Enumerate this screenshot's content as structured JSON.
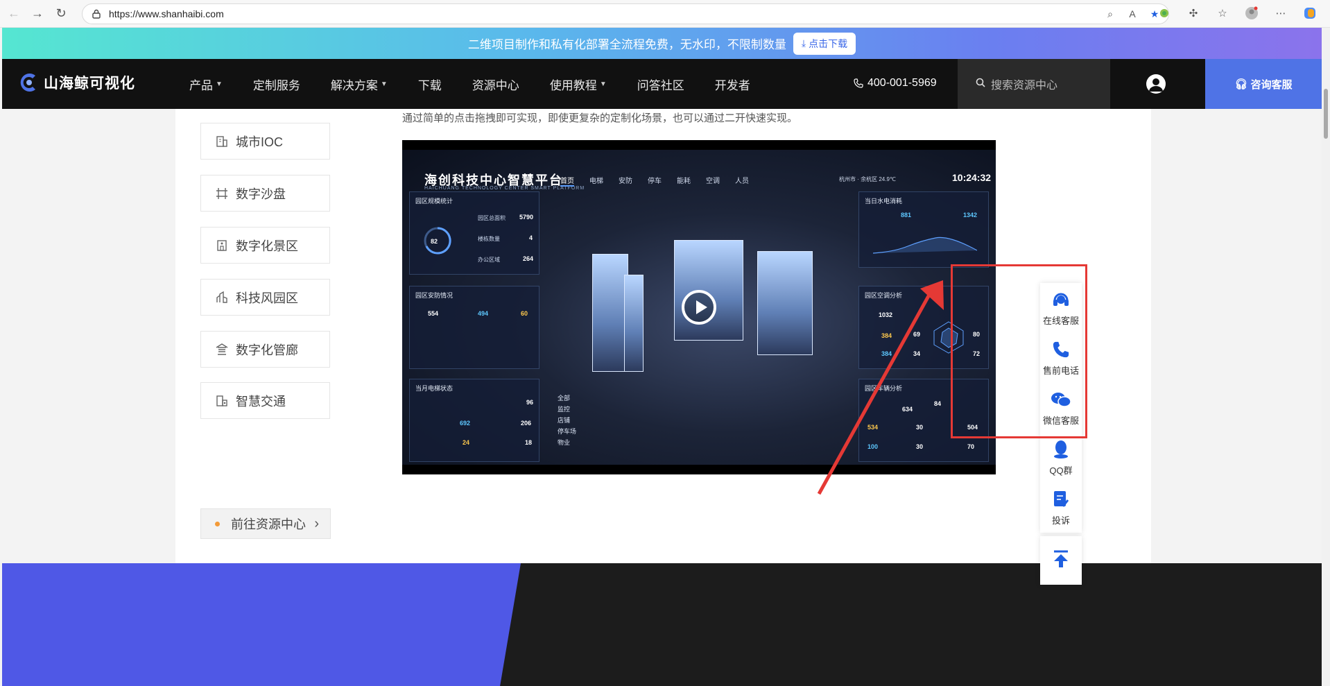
{
  "browser": {
    "url": "https://www.shanhaibi.com"
  },
  "promo": {
    "text": "二维项目制作和私有化部署全流程免费，无水印，不限制数量",
    "button_label": "点击下载"
  },
  "nav": {
    "logo_text": "山海鲸可视化",
    "menu": [
      {
        "label": "产品",
        "dropdown": true
      },
      {
        "label": "定制服务",
        "dropdown": false
      },
      {
        "label": "解决方案",
        "dropdown": true
      },
      {
        "label": "下载",
        "dropdown": false
      },
      {
        "label": "资源中心",
        "dropdown": false
      },
      {
        "label": "使用教程",
        "dropdown": true
      },
      {
        "label": "问答社区",
        "dropdown": false
      },
      {
        "label": "开发者",
        "dropdown": false
      }
    ],
    "phone": "400-001-5969",
    "search_placeholder": "搜索资源中心",
    "consult_label": "咨询客服"
  },
  "content": {
    "intro": "通过简单的点击拖拽即可实现，即使更复杂的定制化场景，也可以通过二开快速实现。",
    "sidebar": [
      {
        "label": "城市IOC",
        "icon": "building-icon"
      },
      {
        "label": "数字沙盘",
        "icon": "frame-icon"
      },
      {
        "label": "数字化景区",
        "icon": "scenic-icon"
      },
      {
        "label": "科技风园区",
        "icon": "park-icon"
      },
      {
        "label": "数字化管廊",
        "icon": "pipe-gallery-icon"
      },
      {
        "label": "智慧交通",
        "icon": "traffic-icon"
      }
    ],
    "goto_label": "前往资源中心"
  },
  "video": {
    "title": "海创科技中心智慧平台",
    "subtitle": "HAICHUANG TECHNOLOGY CENTER SMART PLATFORM",
    "tabs": [
      "首页",
      "电梯",
      "安防",
      "停车",
      "能耗",
      "空调",
      "人员"
    ],
    "location": "杭州市 · 余杭区",
    "temperature": "24.9℃",
    "time": "10:24:32",
    "panels": {
      "park_stats": {
        "title": "园区规模统计",
        "rate": "82",
        "area": "5790",
        "buildings": "4",
        "offices": "264",
        "labels": [
          "园区总面积",
          "楼栋数量",
          "办公区域"
        ]
      },
      "security": {
        "title": "园区安防情况",
        "monitors": "554",
        "normal": "494",
        "faults": "60"
      },
      "elevator": {
        "title": "当月电梯状态",
        "safety_index": "96",
        "normal": "692",
        "abnormal": "206",
        "repairs": "24",
        "stops": "18"
      },
      "energy": {
        "title": "当日水电消耗",
        "water": "881",
        "power": "1342"
      },
      "aircon": {
        "title": "园区空调分析",
        "total": "1032",
        "on": "384",
        "temp": "69",
        "faults": "34",
        "devices": "80",
        "on2": "384",
        "rate": "72"
      },
      "vehicles": {
        "title": "园区车辆分析",
        "spaces": "634",
        "rate": "84",
        "used": "534",
        "ground_used": "30",
        "under_used": "504",
        "free": "100",
        "ground_free": "30",
        "under_free": "70"
      }
    },
    "filters": [
      "全部",
      "监控",
      "店铺",
      "停车场",
      "物业"
    ]
  },
  "float_service": [
    {
      "label": "在线客服",
      "icon": "headset-icon"
    },
    {
      "label": "售前电话",
      "icon": "phone-icon"
    },
    {
      "label": "微信客服",
      "icon": "wechat-icon"
    },
    {
      "label": "QQ群",
      "icon": "qq-icon"
    },
    {
      "label": "投诉",
      "icon": "complaint-icon"
    }
  ],
  "colors": {
    "brand_blue": "#4f73e6",
    "accent_blue": "#1f5fe0",
    "annotation_red": "#e53935",
    "footer_blue": "#4f58e6"
  }
}
